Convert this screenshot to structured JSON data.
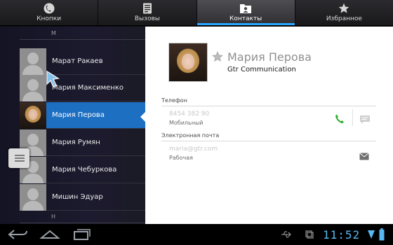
{
  "tabs": [
    {
      "label": "Кнопки",
      "icon": "phone-icon"
    },
    {
      "label": "Вызовы",
      "icon": "call-log-icon"
    },
    {
      "label": "Контакты",
      "icon": "contacts-folder-icon",
      "active": true
    },
    {
      "label": "Избранное",
      "icon": "star-icon"
    }
  ],
  "list": {
    "section_letter_top": "М",
    "section_letter_bottom": "Н",
    "contacts": [
      {
        "name": "Марат Ракаев",
        "photo": false
      },
      {
        "name": "Мария Максименко",
        "photo": false
      },
      {
        "name": "Мария Перова",
        "photo": true,
        "selected": true
      },
      {
        "name": "Мария Румян",
        "photo": false
      },
      {
        "name": "Мария Чебуркова",
        "photo": false
      },
      {
        "name": "Мишин Эдуар",
        "photo": false
      }
    ]
  },
  "detail": {
    "name": "Мария Перова",
    "company": "Gtr Communication",
    "phone_header": "Телефон",
    "phone_value": "8454 382 90",
    "phone_type": "Мобильный",
    "email_header": "Электронная почта",
    "email_value": "maria@gtr.com",
    "email_type": "Рабочая"
  },
  "system_bar": {
    "time": "11:52",
    "accent": "#58b9f2"
  },
  "colors": {
    "selected_row": "#1d6fc2",
    "tab_indicator": "#29a6ff",
    "call_icon": "#2fae2f"
  }
}
